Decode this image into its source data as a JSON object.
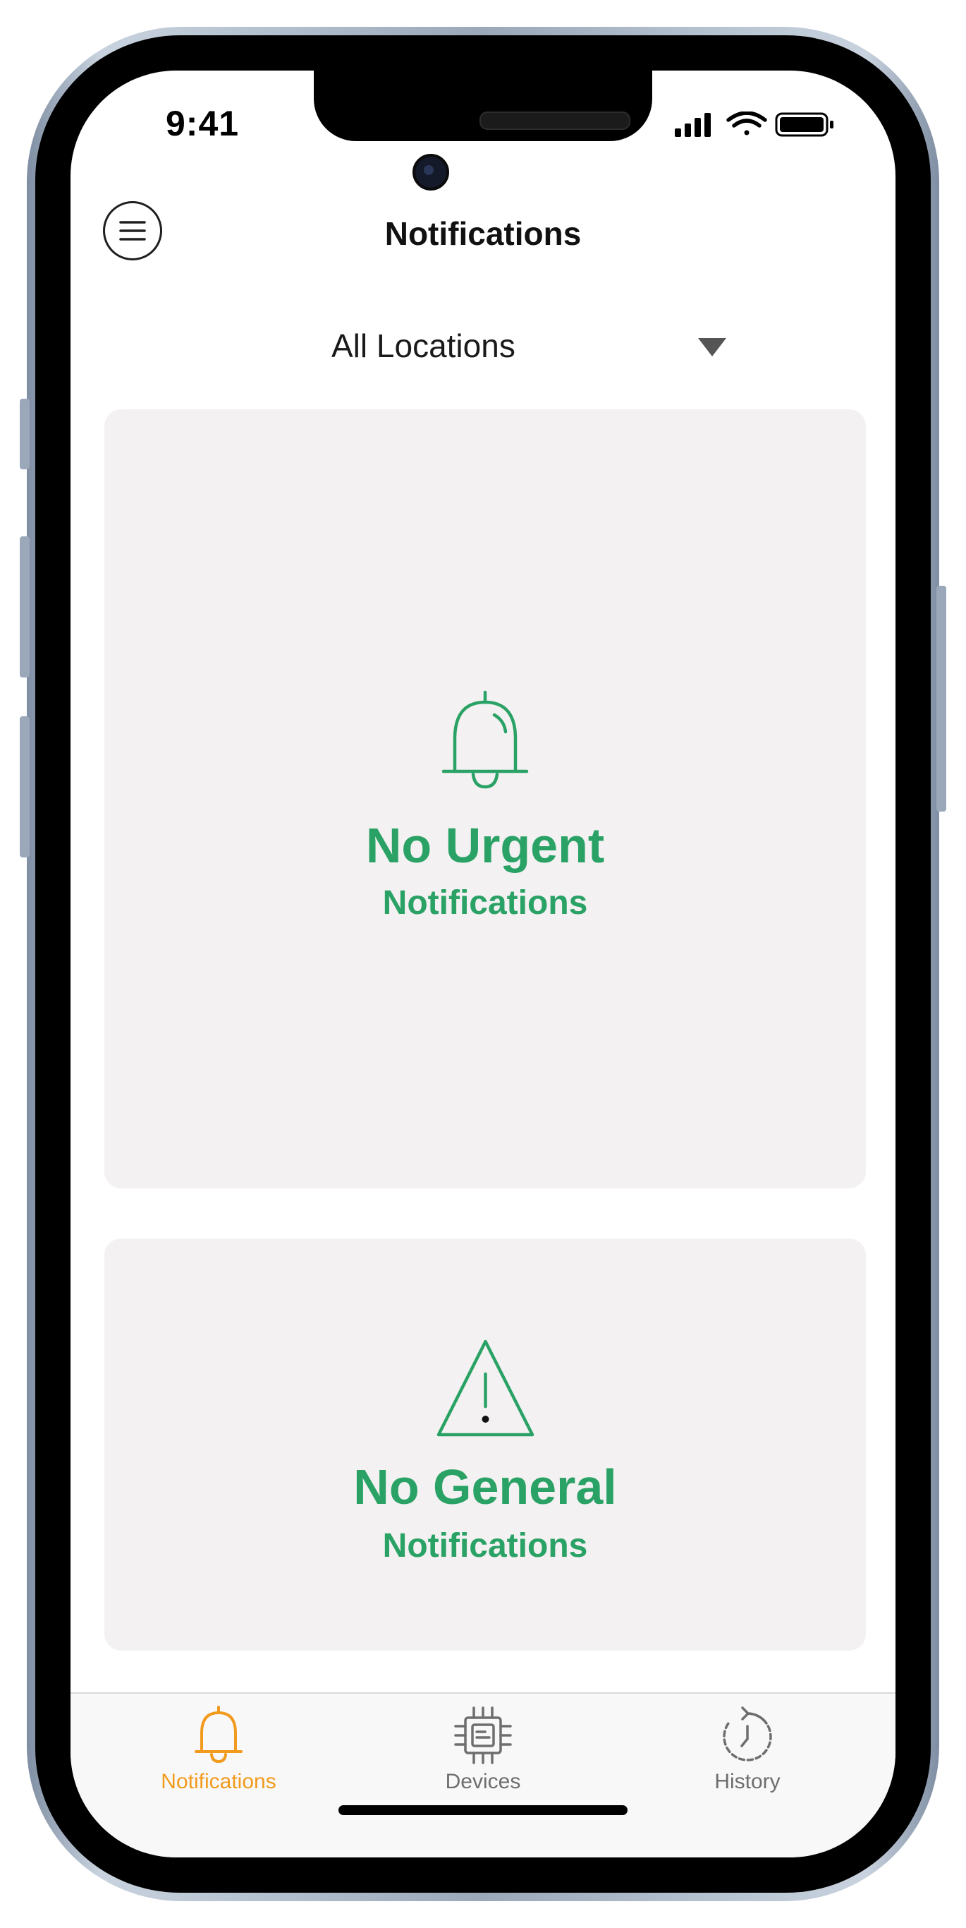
{
  "status_bar": {
    "time": "9:41"
  },
  "header": {
    "title": "Notifications",
    "location": "All Locations"
  },
  "cards": {
    "urgent": {
      "title": "No Urgent",
      "subtitle": "Notifications",
      "icon": "bell-icon"
    },
    "general": {
      "title": "No General",
      "subtitle": "Notifications",
      "icon": "warning-triangle-icon"
    }
  },
  "tabs": [
    {
      "label": "Notifications",
      "icon": "bell-icon",
      "active": true
    },
    {
      "label": "Devices",
      "icon": "chip-icon",
      "active": false
    },
    {
      "label": "History",
      "icon": "history-icon",
      "active": false
    }
  ],
  "colors": {
    "accent_green": "#2aa265",
    "active_tab": "#f29a1d",
    "inactive_tab": "#6e6e6e",
    "card_bg": "#f3f1f2"
  }
}
